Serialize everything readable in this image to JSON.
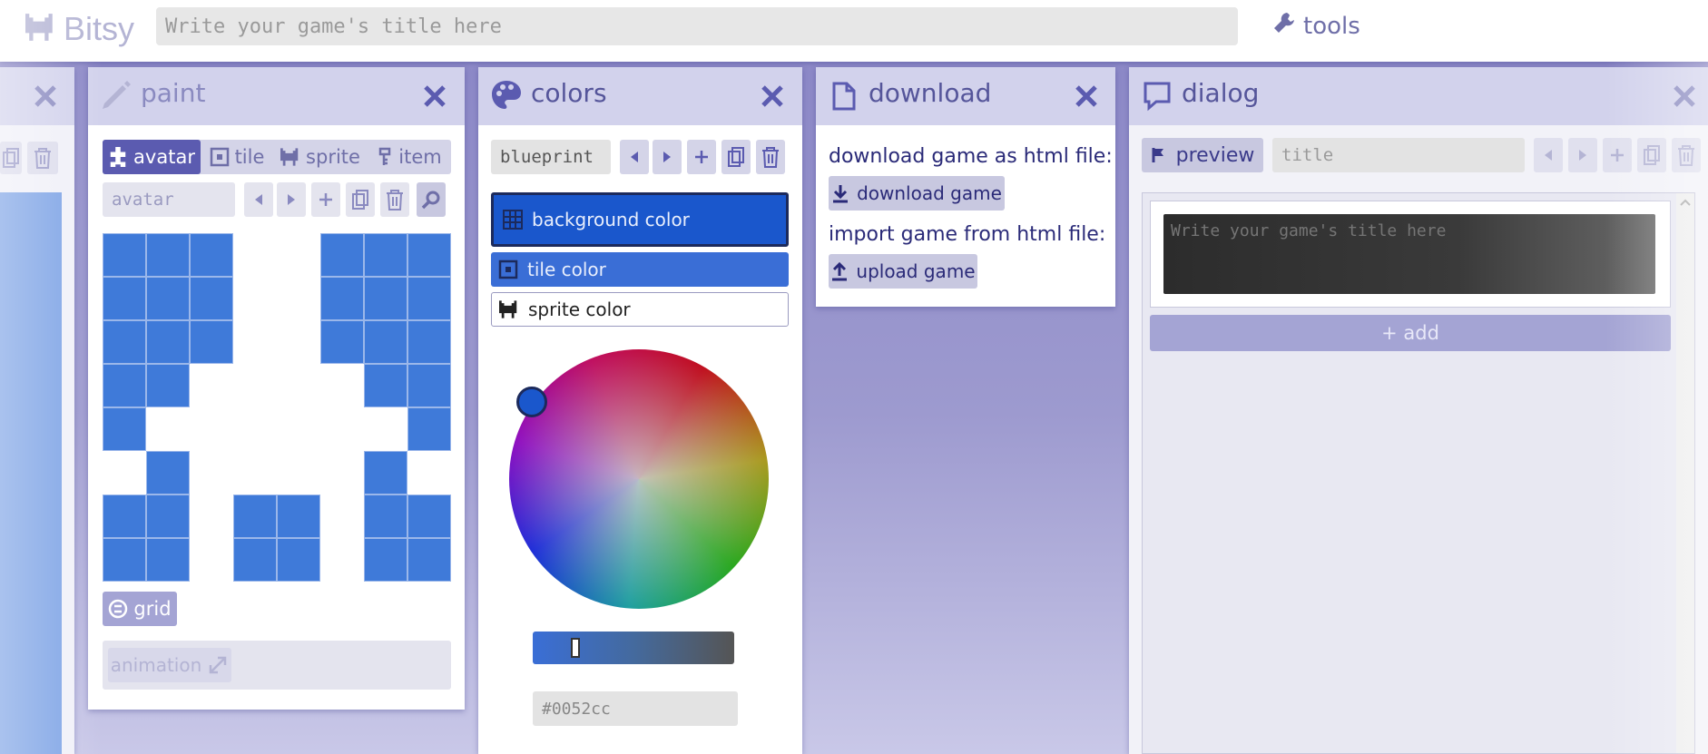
{
  "app": {
    "brand": "Bitsy",
    "title_placeholder": "Write your game's title here",
    "tools_label": "tools"
  },
  "paint": {
    "title": "paint",
    "tabs": [
      "avatar",
      "tile",
      "sprite",
      "item"
    ],
    "name_value": "avatar",
    "grid_label": "grid",
    "animation_label": "animation"
  },
  "colors": {
    "title": "colors",
    "palette_name": "blueprint",
    "options": [
      "background color",
      "tile color",
      "sprite color"
    ],
    "hex_value": "#0052cc",
    "slider_fraction": 0.2,
    "swatches": {
      "background": "#1a57cc",
      "tile": "#3a6ed6",
      "sprite": "#ffffff"
    }
  },
  "download": {
    "title": "download",
    "download_text": "download game as html file:",
    "download_button": "download game",
    "import_text": "import game from html file:",
    "upload_button": "upload game"
  },
  "dialog": {
    "title": "dialog",
    "preview_label": "preview",
    "name_value": "title",
    "text_placeholder": "Write your game's title here",
    "add_label": "+ add"
  },
  "colors_theme": {
    "accent": "#5b5bb0",
    "pixel": "#3f7ad9",
    "panel_head": "#d2d2ec"
  }
}
